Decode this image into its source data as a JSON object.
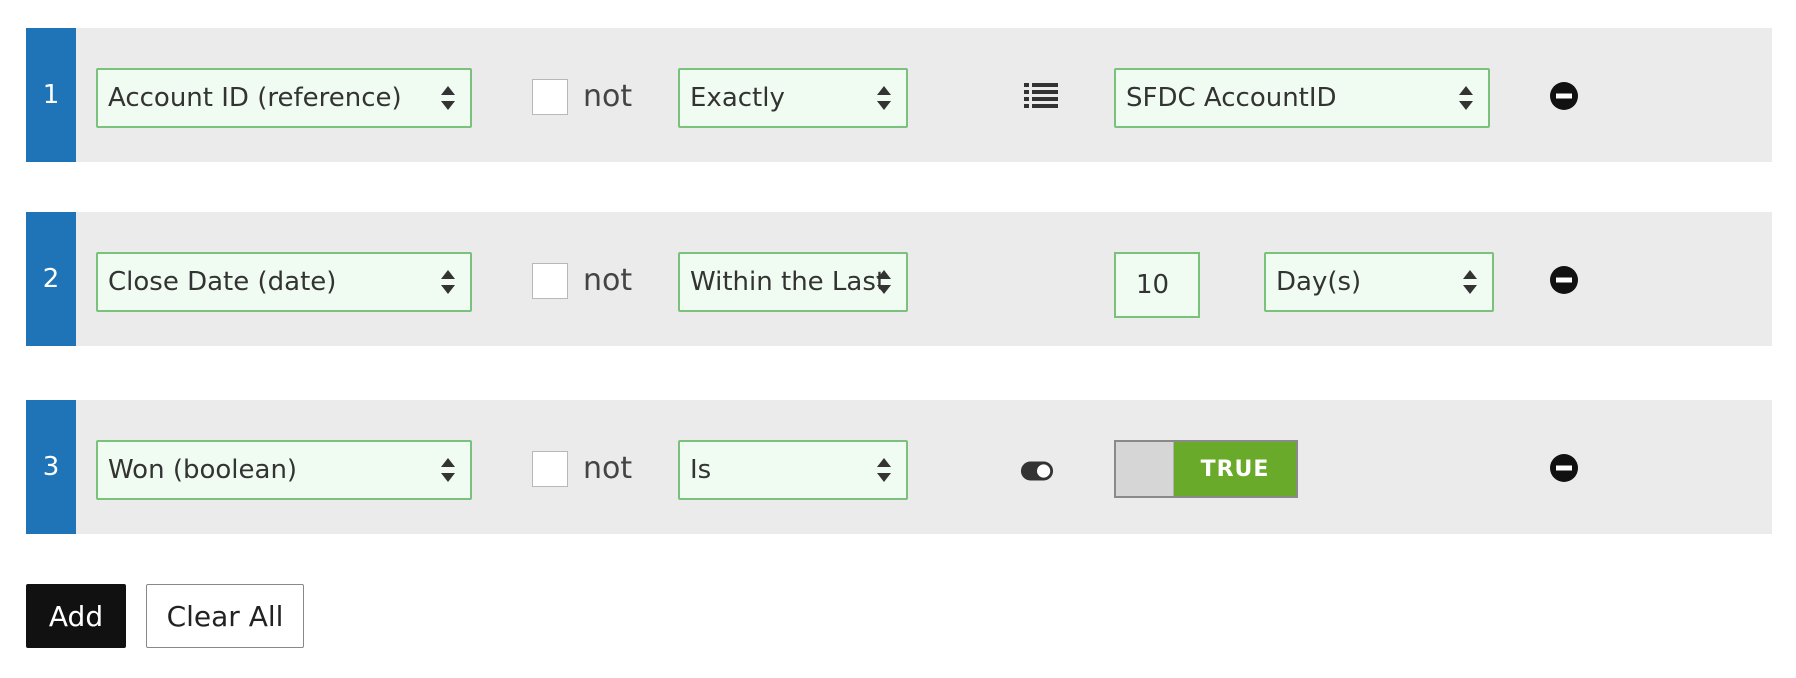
{
  "filters": [
    {
      "number": "1",
      "field": "Account ID (reference)",
      "not_label": "not",
      "not_checked": false,
      "operator": "Exactly",
      "mode_icon": "list-icon",
      "value": "SFDC AccountID",
      "remove_icon": "minus-circle-icon"
    },
    {
      "number": "2",
      "field": "Close Date (date)",
      "not_label": "not",
      "not_checked": false,
      "operator": "Within the Last",
      "amount": "10",
      "unit": "Day(s)",
      "remove_icon": "minus-circle-icon"
    },
    {
      "number": "3",
      "field": "Won (boolean)",
      "not_label": "not",
      "not_checked": false,
      "operator": "Is",
      "mode_icon": "toggle-icon",
      "value": "TRUE",
      "value_on": true,
      "remove_icon": "minus-circle-icon"
    }
  ],
  "actions": {
    "add_label": "Add",
    "clear_label": "Clear All"
  },
  "colors": {
    "row_number_bg": "#1f73b7",
    "field_bg": "#f0fcf1",
    "field_border": "#7ac27c",
    "toggle_on": "#6aaa2a",
    "row_bg": "#ebebeb"
  }
}
